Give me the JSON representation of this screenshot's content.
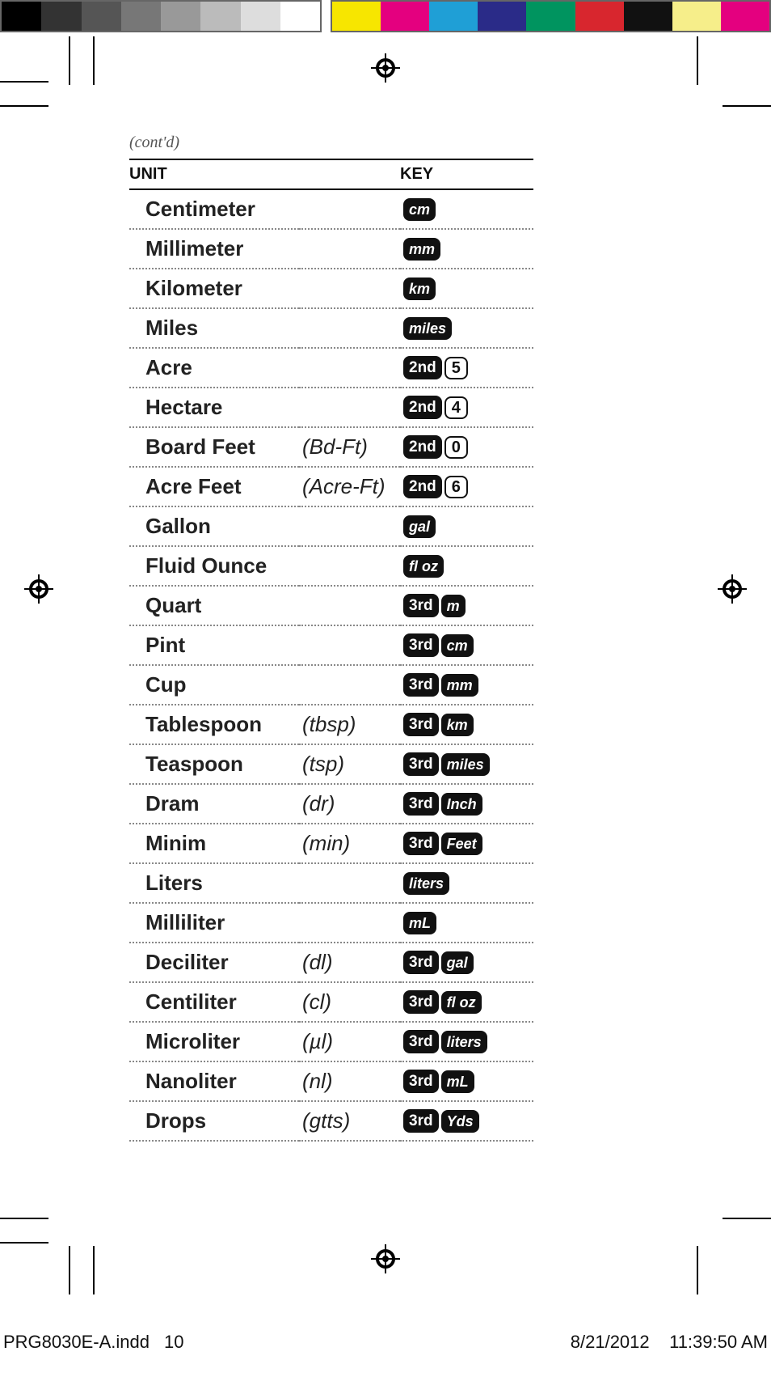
{
  "contd": "(cont'd)",
  "headers": {
    "unit": "UNIT",
    "key": "KEY"
  },
  "rows": [
    {
      "name": "Centimeter",
      "abbr": "",
      "keys": [
        {
          "t": "cm",
          "s": "dark"
        }
      ]
    },
    {
      "name": "Millimeter",
      "abbr": "",
      "keys": [
        {
          "t": "mm",
          "s": "dark"
        }
      ]
    },
    {
      "name": "Kilometer",
      "abbr": "",
      "keys": [
        {
          "t": "km",
          "s": "dark"
        }
      ]
    },
    {
      "name": "Miles",
      "abbr": "",
      "keys": [
        {
          "t": "miles",
          "s": "dark"
        }
      ]
    },
    {
      "name": "Acre",
      "abbr": "",
      "keys": [
        {
          "t": "2nd",
          "s": "dark",
          "mod": true
        },
        {
          "t": "5",
          "s": "light",
          "num": true
        }
      ]
    },
    {
      "name": "Hectare",
      "abbr": "",
      "keys": [
        {
          "t": "2nd",
          "s": "dark",
          "mod": true
        },
        {
          "t": "4",
          "s": "light",
          "num": true
        }
      ]
    },
    {
      "name": "Board Feet",
      "abbr": "(Bd-Ft)",
      "keys": [
        {
          "t": "2nd",
          "s": "dark",
          "mod": true
        },
        {
          "t": "0",
          "s": "light",
          "num": true
        }
      ]
    },
    {
      "name": "Acre Feet",
      "abbr": "(Acre-Ft)",
      "keys": [
        {
          "t": "2nd",
          "s": "dark",
          "mod": true
        },
        {
          "t": "6",
          "s": "light",
          "num": true
        }
      ]
    },
    {
      "name": "Gallon",
      "abbr": "",
      "keys": [
        {
          "t": "gal",
          "s": "dark"
        }
      ]
    },
    {
      "name": "Fluid Ounce",
      "abbr": "",
      "keys": [
        {
          "t": "fl oz",
          "s": "dark"
        }
      ]
    },
    {
      "name": "Quart",
      "abbr": "",
      "keys": [
        {
          "t": "3rd",
          "s": "dark",
          "mod": true
        },
        {
          "t": "m",
          "s": "dark"
        }
      ]
    },
    {
      "name": "Pint",
      "abbr": "",
      "keys": [
        {
          "t": "3rd",
          "s": "dark",
          "mod": true
        },
        {
          "t": "cm",
          "s": "dark"
        }
      ]
    },
    {
      "name": "Cup",
      "abbr": "",
      "keys": [
        {
          "t": "3rd",
          "s": "dark",
          "mod": true
        },
        {
          "t": "mm",
          "s": "dark"
        }
      ]
    },
    {
      "name": "Tablespoon",
      "abbr": "(tbsp)",
      "keys": [
        {
          "t": "3rd",
          "s": "dark",
          "mod": true
        },
        {
          "t": "km",
          "s": "dark"
        }
      ]
    },
    {
      "name": "Teaspoon",
      "abbr": "(tsp)",
      "keys": [
        {
          "t": "3rd",
          "s": "dark",
          "mod": true
        },
        {
          "t": "miles",
          "s": "dark"
        }
      ]
    },
    {
      "name": "Dram",
      "abbr": "(dr)",
      "keys": [
        {
          "t": "3rd",
          "s": "dark",
          "mod": true
        },
        {
          "t": "Inch",
          "s": "dark"
        }
      ]
    },
    {
      "name": "Minim",
      "abbr": "(min)",
      "keys": [
        {
          "t": "3rd",
          "s": "dark",
          "mod": true
        },
        {
          "t": "Feet",
          "s": "dark"
        }
      ]
    },
    {
      "name": "Liters",
      "abbr": "",
      "keys": [
        {
          "t": "liters",
          "s": "dark"
        }
      ]
    },
    {
      "name": "Milliliter",
      "abbr": "",
      "keys": [
        {
          "t": "mL",
          "s": "dark"
        }
      ]
    },
    {
      "name": "Deciliter",
      "abbr": "(dl)",
      "keys": [
        {
          "t": "3rd",
          "s": "dark",
          "mod": true
        },
        {
          "t": "gal",
          "s": "dark"
        }
      ]
    },
    {
      "name": "Centiliter",
      "abbr": "(cl)",
      "keys": [
        {
          "t": "3rd",
          "s": "dark",
          "mod": true
        },
        {
          "t": "fl oz",
          "s": "dark"
        }
      ]
    },
    {
      "name": "Microliter",
      "abbr": "(µl)",
      "keys": [
        {
          "t": "3rd",
          "s": "dark",
          "mod": true
        },
        {
          "t": "liters",
          "s": "dark"
        }
      ]
    },
    {
      "name": "Nanoliter",
      "abbr": "(nl)",
      "keys": [
        {
          "t": "3rd",
          "s": "dark",
          "mod": true
        },
        {
          "t": "mL",
          "s": "dark"
        }
      ]
    },
    {
      "name": "Drops",
      "abbr": "(gtts)",
      "keys": [
        {
          "t": "3rd",
          "s": "dark",
          "mod": true
        },
        {
          "t": "Yds",
          "s": "dark"
        }
      ]
    }
  ],
  "footer": {
    "file": "PRG8030E-A.indd",
    "page": "10",
    "date": "8/21/2012",
    "time": "11:39:50 AM"
  },
  "strip_left": [
    "#000000",
    "#333333",
    "#555555",
    "#777777",
    "#999999",
    "#bbbbbb",
    "#dddddd",
    "#ffffff"
  ],
  "strip_right": [
    "#f7e600",
    "#e4007f",
    "#1f9fd6",
    "#2a2b88",
    "#00945f",
    "#d8262e",
    "#111111",
    "#f6ee8a",
    "#e4007f"
  ]
}
